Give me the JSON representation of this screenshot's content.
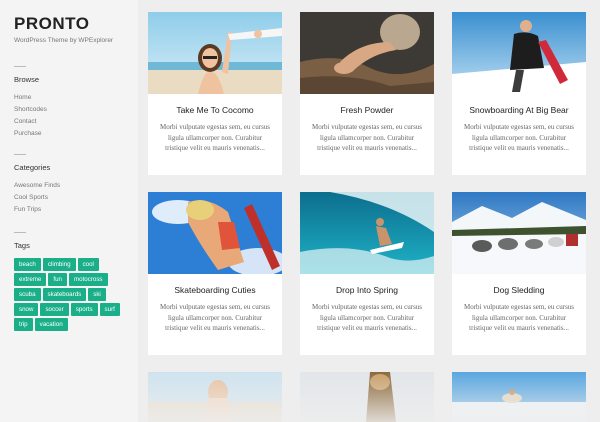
{
  "site": {
    "logo": "PRONTO",
    "tagline": "WordPress Theme by WPExplorer"
  },
  "browse": {
    "title": "Browse",
    "items": [
      "Home",
      "Shortcodes",
      "Contact",
      "Purchase"
    ]
  },
  "categories": {
    "title": "Categories",
    "items": [
      "Awesome Finds",
      "Cool Sports",
      "Fun Trips"
    ]
  },
  "tags": {
    "title": "Tags",
    "items": [
      "beach",
      "climbing",
      "cool",
      "extreme",
      "fun",
      "motocross",
      "scuba",
      "skateboards",
      "ski",
      "snow",
      "soccer",
      "sports",
      "surf",
      "trip",
      "vacation"
    ],
    "accent_color": "#1aaf88"
  },
  "posts": [
    {
      "title": "Take Me To Cocomo",
      "excerpt": "Morbi vulputate egestas sem, eu cursus ligula ullamcorper non. Curabitur tristique velit eu mauris venenatis..."
    },
    {
      "title": "Fresh Powder",
      "excerpt": "Morbi vulputate egestas sem, eu cursus ligula ullamcorper non. Curabitur tristique velit eu mauris venenatis..."
    },
    {
      "title": "Snowboarding At Big Bear",
      "excerpt": "Morbi vulputate egestas sem, eu cursus ligula ullamcorper non. Curabitur tristique velit eu mauris venenatis..."
    },
    {
      "title": "Skateboarding Cuties",
      "excerpt": "Morbi vulputate egestas sem, eu cursus ligula ullamcorper non. Curabitur tristique velit eu mauris venenatis..."
    },
    {
      "title": "Drop Into Spring",
      "excerpt": "Morbi vulputate egestas sem, eu cursus ligula ullamcorper non. Curabitur tristique velit eu mauris venenatis..."
    },
    {
      "title": "Dog Sledding",
      "excerpt": "Morbi vulputate egestas sem, eu cursus ligula ullamcorper non. Curabitur tristique velit eu mauris venenatis..."
    }
  ]
}
